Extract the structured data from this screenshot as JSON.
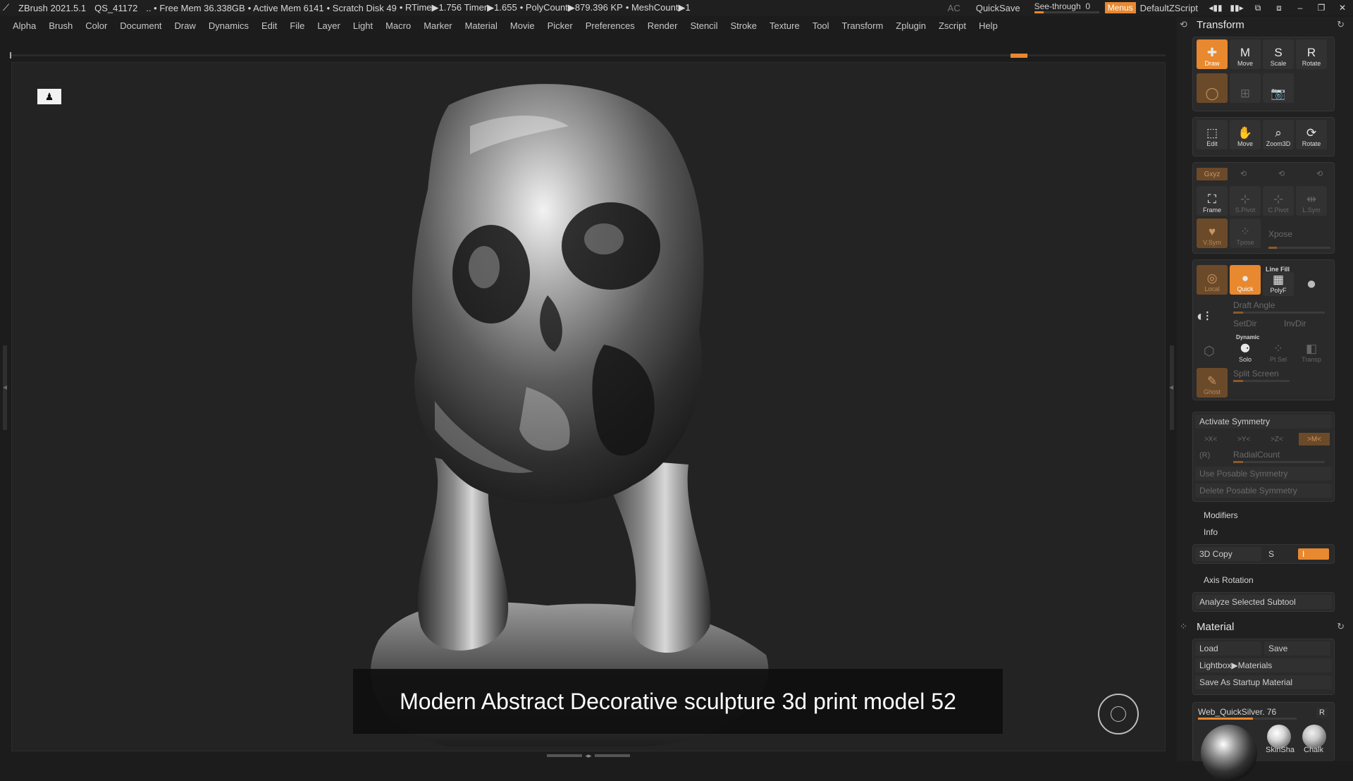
{
  "titlebar": {
    "app": "ZBrush 2021.5.1",
    "id": "QS_41172",
    "free_mem": ".. • Free Mem 36.338GB",
    "active_mem": "• Active Mem 6141",
    "scratch": "• Scratch Disk 49",
    "rtime": "• RTime▶1.756 Timer▶1.655",
    "polycount": "• PolyCount▶879.396 KP",
    "meshcount": "• MeshCount▶1",
    "ac": "AC",
    "quicksave": "QuickSave",
    "see_through": "See-through",
    "see_through_value": "0",
    "see_through_level": 0.15,
    "menus": "Menus",
    "script": "DefaultZScript"
  },
  "menubar": [
    "Alpha",
    "Brush",
    "Color",
    "Document",
    "Draw",
    "Dynamics",
    "Edit",
    "File",
    "Layer",
    "Light",
    "Macro",
    "Marker",
    "Material",
    "Movie",
    "Picker",
    "Preferences",
    "Render",
    "Stencil",
    "Stroke",
    "Texture",
    "Tool",
    "Transform",
    "Zplugin",
    "Zscript",
    "Help"
  ],
  "viewport": {
    "caption": "Modern Abstract Decorative sculpture 3d print model 52"
  },
  "transform": {
    "title": "Transform",
    "tools_row1": [
      "Draw",
      "Move",
      "Scale",
      "Rotate"
    ],
    "tools_row3": [
      "Edit",
      "Move",
      "Zoom3D",
      "Rotate"
    ],
    "xyz": "Gxyz",
    "frame": "Frame",
    "spivot": "S.Pivot",
    "cpivot": "C.Pivot",
    "lsym": "L.Sym",
    "vsym": "V.Sym",
    "tpose": "Tpose",
    "xpose": "Xpose",
    "local": "Local",
    "quick": "Quick",
    "line_fill": "Line Fill",
    "polyf": "PolyF",
    "draft_angle": "Draft Angle",
    "setdir": "SetDir",
    "invdir": "InvDir",
    "dynamic": "Dynamic",
    "solo": "Solo",
    "ptsel": "Pt Sel",
    "transp": "Transp",
    "split_screen": "Split Screen",
    "ghost": "Ghost",
    "activate_symmetry": "Activate Symmetry",
    "sym_x": ">X<",
    "sym_y": ">Y<",
    "sym_z": ">Z<",
    "sym_m": ">M<",
    "r_label": "(R)",
    "radial_count": "RadialCount",
    "use_posable": "Use Posable Symmetry",
    "delete_posable": "Delete Posable Symmetry",
    "modifiers": "Modifiers",
    "info": "Info",
    "copy3d": "3D Copy",
    "copy_s": "S",
    "copy_i": "I",
    "axis_rotation": "Axis Rotation",
    "analyze": "Analyze Selected Subtool"
  },
  "material": {
    "title": "Material",
    "load": "Load",
    "save": "Save",
    "lightbox": "Lightbox▶Materials",
    "save_startup": "Save As Startup Material",
    "current": "Web_QuickSilver. 76",
    "r": "R",
    "swatches": [
      "SkinSha",
      "Chalk"
    ]
  },
  "colors": {
    "accent": "#e8882f",
    "panel": "#202020",
    "viewport": "#232323"
  }
}
